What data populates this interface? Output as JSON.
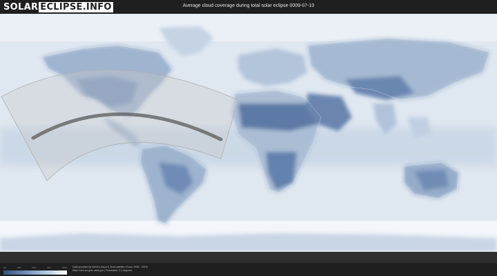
{
  "logo": {
    "part1": "SOLAR",
    "part2": "ECLIPSE.INFO"
  },
  "title": "Average cloud coverage during total solar eclipse 0009-07-10",
  "legend": {
    "ticks": [
      "0%",
      "25%",
      "50%",
      "75%",
      "100%"
    ],
    "colors": {
      "low": "#35527f",
      "mid": "#6f8fb8",
      "high": "#ffffff"
    }
  },
  "credits": {
    "line1": "Data provided by NASA's Aqua & Terra satellite (Years: 2000 - 2019)",
    "line2": "https://neo.sci.gsfc.nasa.gov | Resolution: 0.1 degrees"
  },
  "colors": {
    "ocean_cloud": "#dfe7f0",
    "clear_sky": "#5874a0",
    "overlay": "#c8c8c8",
    "path": "#5a5a5a"
  }
}
